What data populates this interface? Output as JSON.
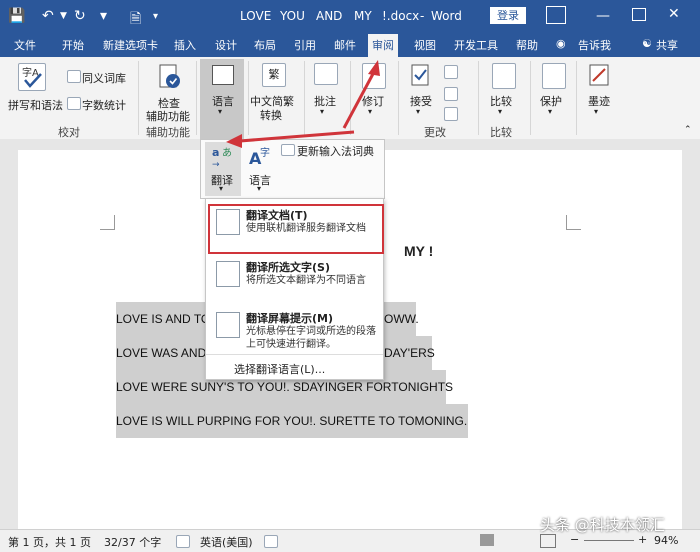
{
  "window": {
    "title_parts": [
      "LOVE",
      "YOU",
      "AND",
      "MY",
      "!.docx",
      "-",
      "Word"
    ],
    "login_label": "登录"
  },
  "tabs": [
    "文件",
    "开始",
    "新建选项卡",
    "插入",
    "设计",
    "布局",
    "引用",
    "邮件",
    "审阅",
    "视图",
    "开发工具",
    "帮助"
  ],
  "active_tab": "审阅",
  "tell_me": "告诉我",
  "share": "共享",
  "ribbon": {
    "proofing": {
      "spell": "拼写和语法",
      "thesaurus": "同义词库",
      "wordcount": "字数统计",
      "group": "校对"
    },
    "accessibility": {
      "check": "检查",
      "check2": "辅助功能",
      "group": "辅助功能"
    },
    "language": {
      "label": "语言"
    },
    "chinese": {
      "label1": "中文简繁",
      "label2": "转换"
    },
    "comment": {
      "label": "批注"
    },
    "track": {
      "label": "修订"
    },
    "changes": {
      "accept": "接受",
      "group": "更改"
    },
    "compare": {
      "label": "比较",
      "group": "比较"
    },
    "protect": {
      "label": "保护"
    },
    "ink": {
      "label": "墨迹"
    }
  },
  "lang_panel": {
    "translate": "翻译",
    "language": "语言",
    "update_ime": "更新输入法词典"
  },
  "menu": {
    "items": [
      {
        "title": "翻译文档(T)",
        "desc": "使用联机翻译服务翻译文档"
      },
      {
        "title": "翻译所选文字(S)",
        "desc": "将所选文本翻译为不同语言"
      },
      {
        "title": "翻译屏幕提示(M)",
        "desc": "光标悬停在字词或所选的段落上可快速进行翻译。"
      }
    ],
    "choose_lang": "选择翻译语言(L)..."
  },
  "document": {
    "heading": "MY  !",
    "lines": [
      {
        "left": "LOVE IS AND TO",
        "right": "OWW."
      },
      {
        "left": "LOVE WAS AND",
        "right": "DAY'ERS"
      },
      {
        "full": "LOVE WERE SUNY'S TO YOU!. SDAYINGER FORTONIGHTS"
      },
      {
        "full": "LOVE IS WILL PURPING FOR YOU!. SURETTE TO TOMONING."
      }
    ]
  },
  "status": {
    "page": "第 1 页，共 1 页",
    "words": "32/37 个字",
    "lang": "英语(美国)",
    "zoom": "94%"
  },
  "watermark": "头条 @科技本领汇"
}
